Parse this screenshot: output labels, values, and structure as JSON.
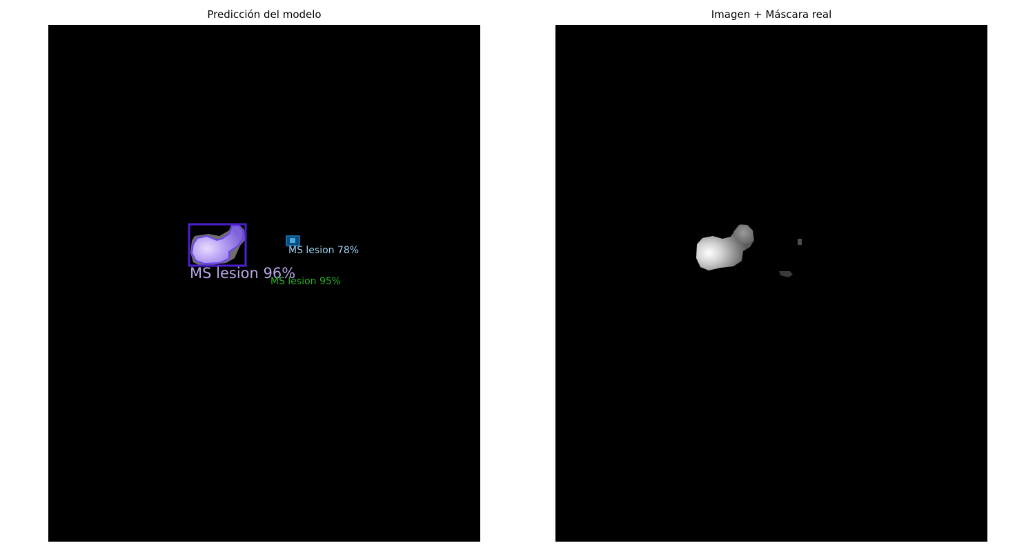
{
  "figure": {
    "left_panel": {
      "title": "Predicción del modelo",
      "detections": [
        {
          "label": "MS lesion 96%",
          "color": "#b7a6e6"
        },
        {
          "label": "MS lesion 95%",
          "color": "#22b422"
        },
        {
          "label": "MS lesion 78%",
          "color": "#9fd3ee"
        }
      ],
      "mask_color": "#8a6cf0",
      "box_color": "#4b1fd0"
    },
    "right_panel": {
      "title": "Imagen + Máscara real"
    }
  }
}
